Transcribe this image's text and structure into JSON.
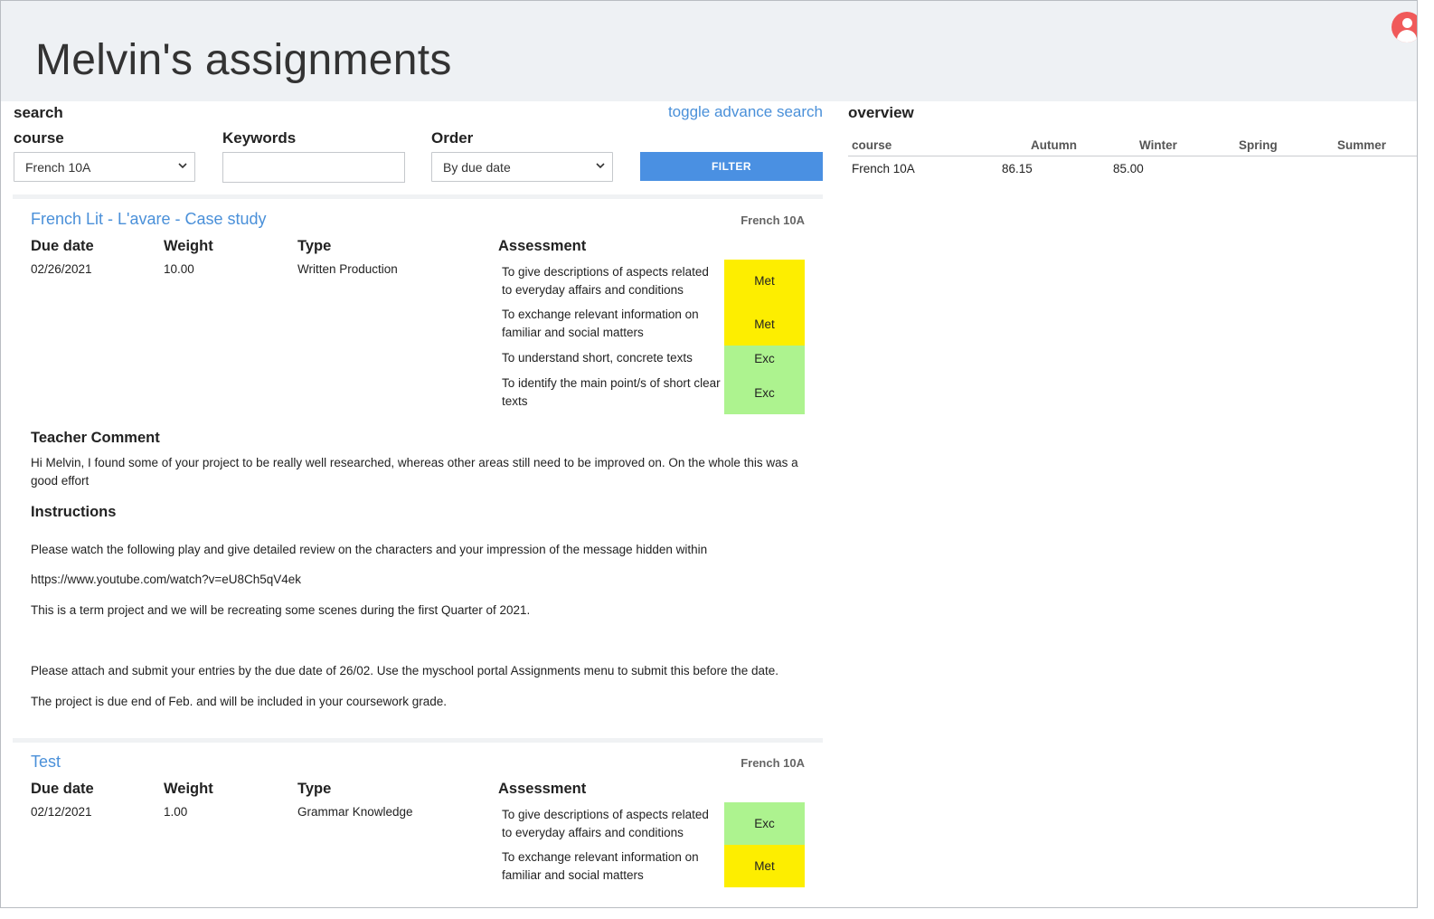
{
  "header": {
    "title": "Melvin's assignments"
  },
  "search": {
    "label": "search",
    "toggle_advanced": "toggle advance search",
    "course_label": "course",
    "course_value": "French 10A",
    "keywords_label": "Keywords",
    "keywords_value": "",
    "order_label": "Order",
    "order_value": "By due date",
    "filter_button": "FILTER"
  },
  "column_labels": {
    "due_date": "Due date",
    "weight": "Weight",
    "type": "Type",
    "assessment": "Assessment",
    "teacher_comment": "Teacher Comment",
    "instructions": "Instructions"
  },
  "assignments": [
    {
      "title": "French Lit - L'avare - Case study",
      "course": "French 10A",
      "due_date": "02/26/2021",
      "weight": "10.00",
      "type": "Written Production",
      "assessments": [
        {
          "criterion": "To give descriptions of aspects related to everyday affairs and conditions",
          "grade": "Met",
          "color": "#fdee00"
        },
        {
          "criterion": "To exchange relevant information on familiar and social matters",
          "grade": "Met",
          "color": "#fdee00"
        },
        {
          "criterion": "To understand short, concrete texts",
          "grade": "Exc",
          "color": "#adf38f"
        },
        {
          "criterion": "To identify the main point/s of short clear texts",
          "grade": "Exc",
          "color": "#adf38f"
        }
      ],
      "teacher_comment": "Hi Melvin, I found some of your project to be really well researched, whereas other areas still need to be improved on. On the whole this was a good effort",
      "instructions": [
        "Please watch the following play and give detailed review on the characters and your impression of the message hidden within",
        "https://www.youtube.com/watch?v=eU8Ch5qV4ek",
        "This is a term project and we will be recreating some scenes during the first Quarter of 2021.",
        "Please attach and submit your entries by the due date of 26/02. Use the myschool portal Assignments menu to submit this before the date.",
        "The project is due end of Feb. and will be included in your coursework grade."
      ]
    },
    {
      "title": "Test",
      "course": "French 10A",
      "due_date": "02/12/2021",
      "weight": "1.00",
      "type": "Grammar Knowledge",
      "assessments": [
        {
          "criterion": "To give descriptions of aspects related to everyday affairs and conditions",
          "grade": "Exc",
          "color": "#adf38f"
        },
        {
          "criterion": "To exchange relevant information on familiar and social matters",
          "grade": "Met",
          "color": "#fdee00"
        }
      ]
    }
  ],
  "overview": {
    "label": "overview",
    "headers": [
      "course",
      "Autumn",
      "Winter",
      "Spring",
      "Summer"
    ],
    "rows": [
      {
        "course": "French 10A",
        "autumn": "86.15",
        "winter": "85.00",
        "spring": "",
        "summer": ""
      }
    ]
  },
  "icons": {
    "avatar": "user-avatar-icon",
    "chevron": "chevron-down-icon"
  },
  "colors": {
    "accent": "#4a90d9",
    "met": "#fdee00",
    "exc": "#adf38f",
    "header_bg": "#eef1f4"
  }
}
